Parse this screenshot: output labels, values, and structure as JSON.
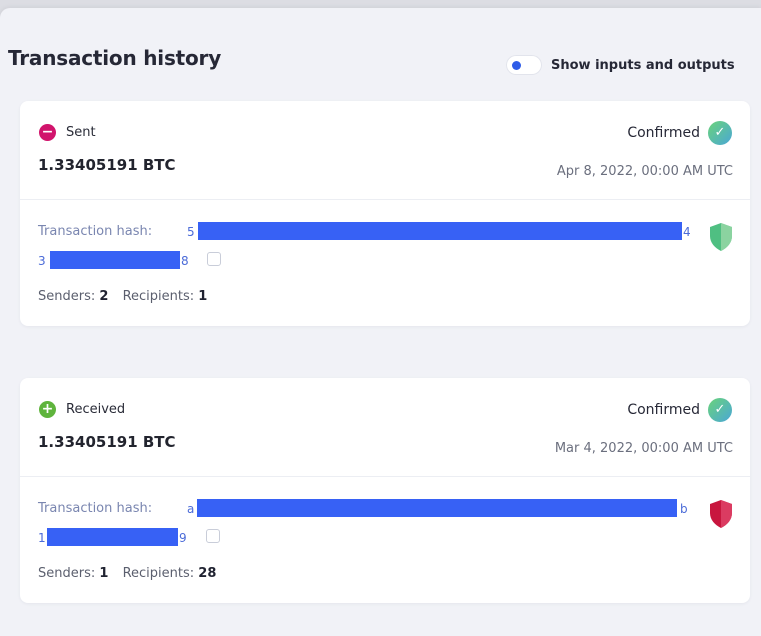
{
  "header": {
    "title": "Transaction history",
    "toggle_label": "Show inputs and outputs"
  },
  "transactions": [
    {
      "direction": "Sent",
      "amount": "1.33405191 BTC",
      "status": "Confirmed",
      "date": "Apr 8, 2022, 00:00 AM UTC",
      "hash_label": "Transaction hash:",
      "hash_line1_start": "5",
      "hash_line1_end": "4",
      "hash_line2_start": "3",
      "hash_line2_end": "8",
      "senders_label": "Senders:",
      "senders": "2",
      "recipients_label": "Recipients:",
      "recipients": "1",
      "risk_color": "#4fbf82"
    },
    {
      "direction": "Received",
      "amount": "1.33405191 BTC",
      "status": "Confirmed",
      "date": "Mar 4, 2022, 00:00 AM UTC",
      "hash_label": "Transaction hash:",
      "hash_line1_start": "a",
      "hash_line1_end": "b",
      "hash_line2_start": "1",
      "hash_line2_end": "9",
      "senders_label": "Senders:",
      "senders": "1",
      "recipients_label": "Recipients:",
      "recipients": "28",
      "risk_color": "#c8163e"
    }
  ],
  "colors": {
    "accent": "#2f5ce8",
    "sent": "#d1146c",
    "received": "#5fb43d",
    "redaction": "#3761f5"
  },
  "icons": {
    "sent": "minus-circle-icon",
    "received": "plus-circle-icon",
    "confirmed": "check-badge-icon",
    "copy": "copy-icon",
    "risk": "shield-icon"
  }
}
